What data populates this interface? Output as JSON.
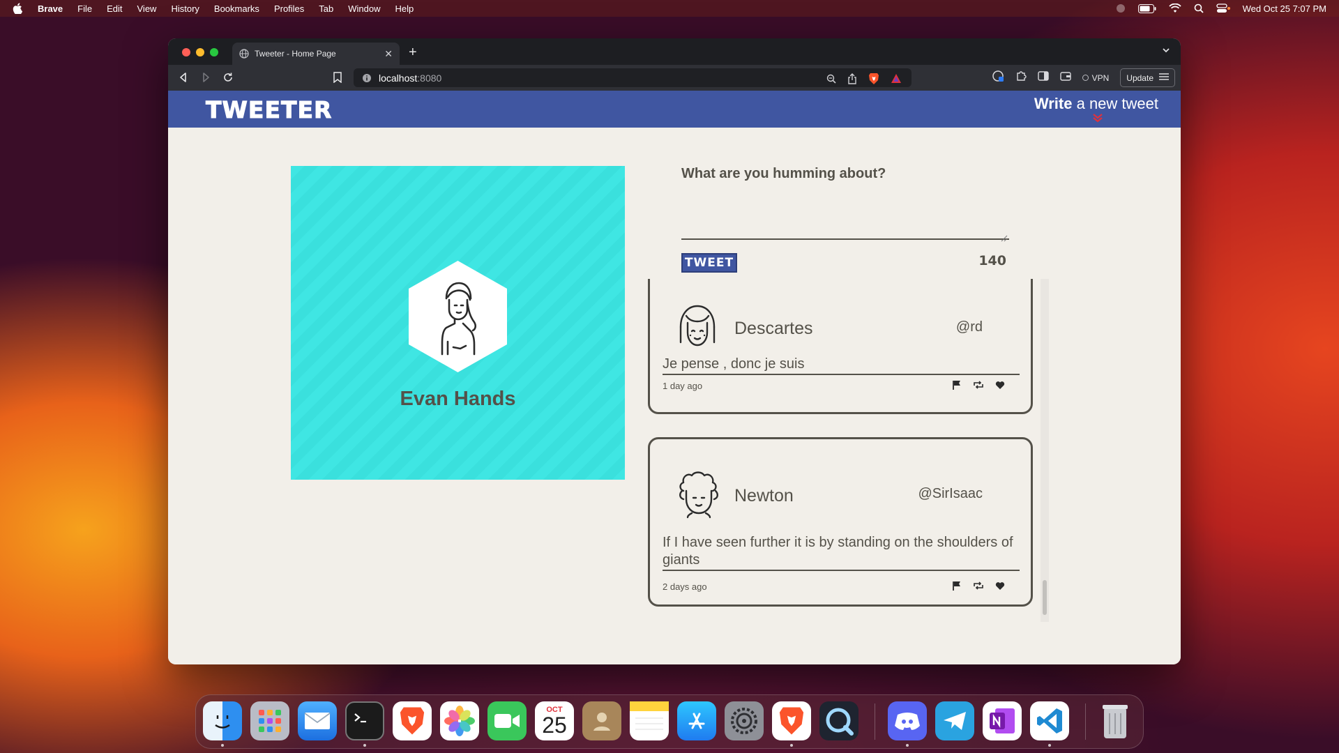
{
  "menubar": {
    "app_name": "Brave",
    "items": [
      "File",
      "Edit",
      "View",
      "History",
      "Bookmarks",
      "Profiles",
      "Tab",
      "Window",
      "Help"
    ],
    "clock": "Wed Oct 25  7:07 PM"
  },
  "browser": {
    "tab_title": "Tweeter - Home Page",
    "url_host": "localhost",
    "url_port": ":8080",
    "vpn_label": "VPN",
    "update_label": "Update"
  },
  "site": {
    "brand": "TWEETER",
    "write_bold": "Write",
    "write_rest": " a new tweet"
  },
  "profile": {
    "name": "Evan Hands"
  },
  "compose": {
    "label": "What are you humming about?",
    "button": "TWEET",
    "counter": "140"
  },
  "tweets": [
    {
      "name": "Descartes",
      "handle": "@rd",
      "content": "Je pense , donc je suis",
      "time": "1 day ago"
    },
    {
      "name": "Newton",
      "handle": "@SirIsaac",
      "content": "If I have seen further it is by standing on the shoulders of giants",
      "time": "2 days ago"
    }
  ],
  "dock": {
    "apps": [
      "Finder",
      "Launchpad",
      "Mail",
      "Terminal",
      "Brave",
      "Photos",
      "FaceTime",
      "Calendar",
      "Contacts",
      "Notes",
      "App Store",
      "System Settings",
      "Brave",
      "QuickTime",
      "Discord",
      "Telegram",
      "OneNote",
      "Visual Studio Code",
      "Trash"
    ],
    "calendar_month": "OCT",
    "calendar_day": "25"
  },
  "colors": {
    "nav_blue": "#4056a1",
    "profile_cyan": "#3fe6e3",
    "page_bg": "#f2efe9",
    "text": "#545149",
    "accent_red": "#e0323c"
  }
}
